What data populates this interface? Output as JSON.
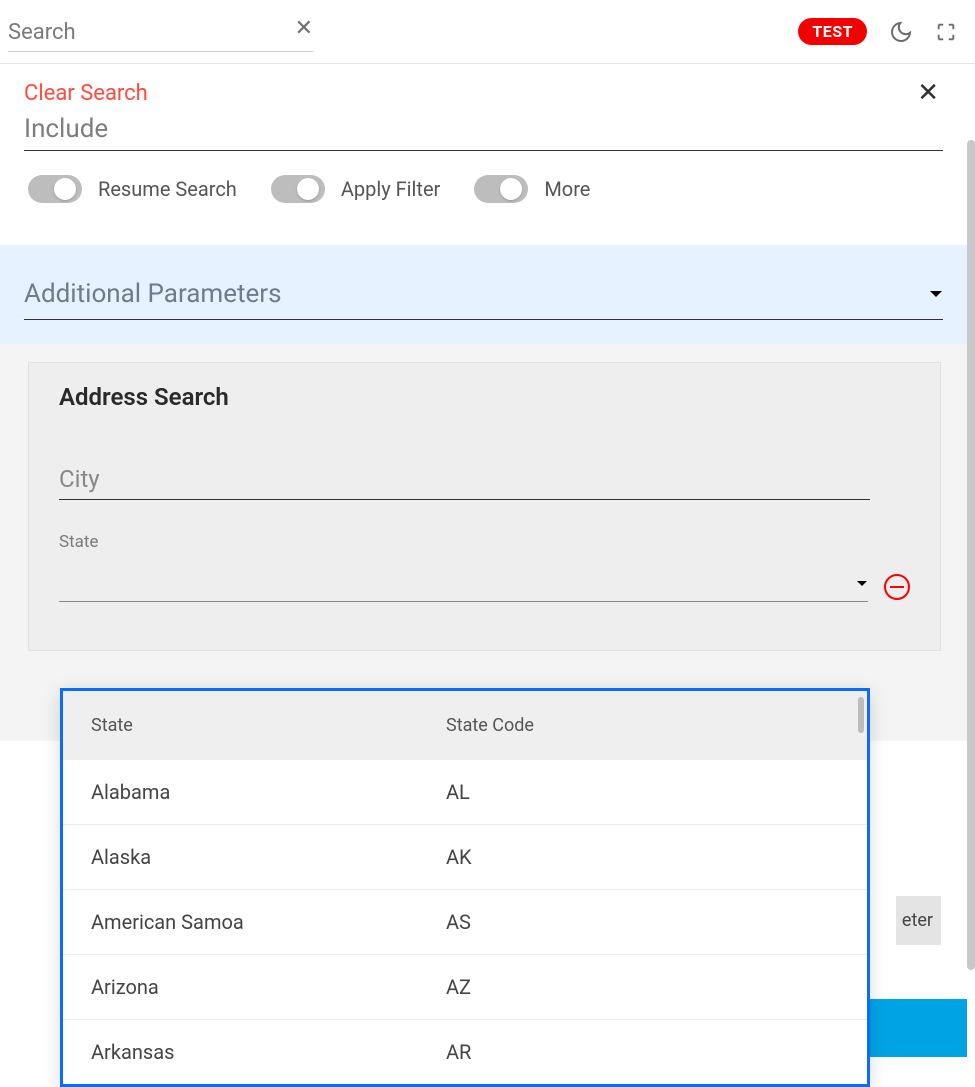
{
  "topbar": {
    "search_placeholder": "Search",
    "test_badge": "TEST"
  },
  "dialog": {
    "clear_search": "Clear Search",
    "include_label": "Include",
    "toggles": {
      "resume_search": "Resume Search",
      "apply_filter": "Apply Filter",
      "more": "More"
    },
    "additional_parameters": "Additional Parameters",
    "address_search_title": "Address Search",
    "city_placeholder": "City",
    "state_label": "State",
    "add_parameter_fragment": "eter"
  },
  "dropdown": {
    "header_state": "State",
    "header_code": "State Code",
    "rows": [
      {
        "name": "Alabama",
        "code": "AL"
      },
      {
        "name": "Alaska",
        "code": "AK"
      },
      {
        "name": "American Samoa",
        "code": "AS"
      },
      {
        "name": "Arizona",
        "code": "AZ"
      },
      {
        "name": "Arkansas",
        "code": "AR"
      }
    ]
  }
}
